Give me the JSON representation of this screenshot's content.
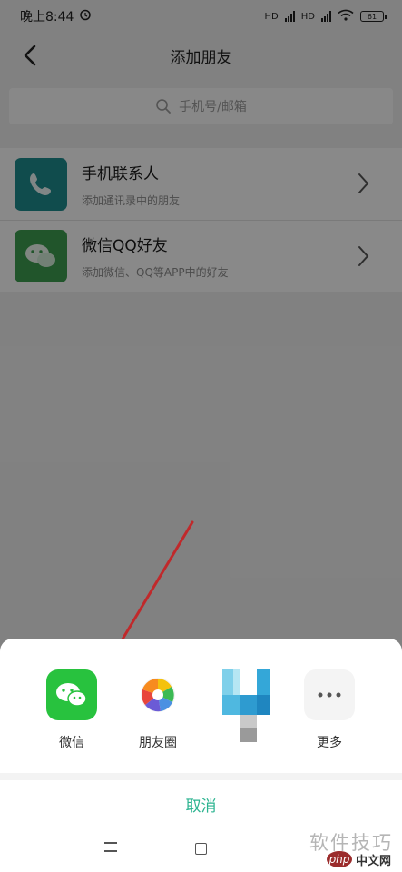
{
  "status_bar": {
    "time": "晚上8:44",
    "signal_1": "HD",
    "signal_2": "HD",
    "battery": "61"
  },
  "nav": {
    "title": "添加朋友"
  },
  "search": {
    "placeholder": "手机号/邮箱"
  },
  "list": {
    "items": [
      {
        "title": "手机联系人",
        "subtitle": "添加通讯录中的朋友",
        "icon": "phone-icon",
        "color": "#1e8a8c"
      },
      {
        "title": "微信QQ好友",
        "subtitle": "添加微信、QQ等APP中的好友",
        "icon": "wechat-icon",
        "color": "#3d9b4f"
      }
    ]
  },
  "share_sheet": {
    "items": [
      {
        "label": "微信",
        "icon": "wechat-icon"
      },
      {
        "label": "朋友圈",
        "icon": "moments-icon"
      },
      {
        "label": "",
        "icon": "pixelated-app-icon"
      },
      {
        "label": "更多",
        "icon": "more-icon"
      }
    ],
    "cancel_label": "取消"
  },
  "watermark": {
    "text": "软件技巧",
    "logo_php": "php",
    "logo_cn": "中文网"
  },
  "colors": {
    "accent": "#2ab38f",
    "arrow": "#c0292b"
  }
}
